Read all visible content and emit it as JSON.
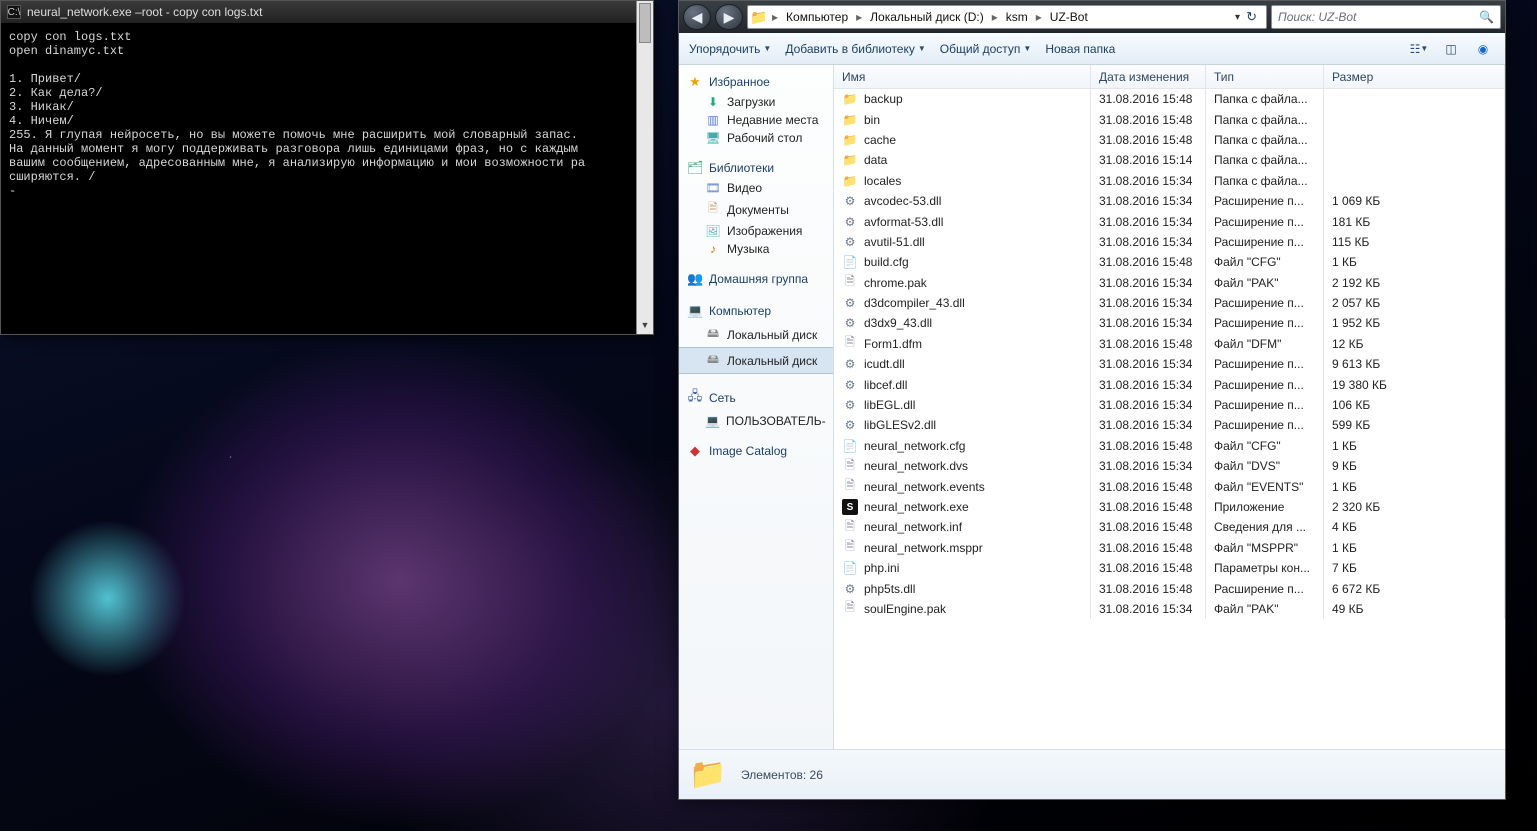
{
  "terminal": {
    "title": "neural_network.exe –root - copy  con logs.txt",
    "lines": "copy con logs.txt\nopen dinamyc.txt\n\n1. Привет/\n2. Как дела?/\n3. Никак/\n4. Ничем/\n255. Я глупая нейросеть, но вы можете помочь мне расширить мой словарный запас.\nНа данный момент я могу поддерживать разговора лишь единицами фраз, но с каждым\nвашим сообщением, адресованным мне, я анализирую информацию и мои возможности ра\nсширяются. /\n-"
  },
  "explorer": {
    "breadcrumb": [
      "Компьютер",
      "Локальный диск (D:)",
      "ksm",
      "UZ-Bot"
    ],
    "search_placeholder": "Поиск: UZ-Bot",
    "toolbar": {
      "organize": "Упорядочить",
      "library": "Добавить в библиотеку",
      "share": "Общий доступ",
      "newfolder": "Новая папка"
    },
    "sidebar": {
      "fav": {
        "head": "Избранное",
        "items": [
          "Загрузки",
          "Недавние места",
          "Рабочий стол"
        ]
      },
      "lib": {
        "head": "Библиотеки",
        "items": [
          "Видео",
          "Документы",
          "Изображения",
          "Музыка"
        ]
      },
      "home": {
        "head": "Домашняя группа"
      },
      "comp": {
        "head": "Компьютер",
        "items": [
          "Локальный диск",
          "Локальный диск"
        ]
      },
      "net": {
        "head": "Сеть",
        "items": [
          "ПОЛЬЗОВАТЕЛЬ-"
        ]
      },
      "catalog": {
        "head": "Image Catalog"
      }
    },
    "columns": {
      "name": "Имя",
      "date": "Дата изменения",
      "type": "Тип",
      "size": "Размер"
    },
    "files": [
      {
        "ico": "folder",
        "name": "backup",
        "date": "31.08.2016 15:48",
        "type": "Папка с файла...",
        "size": ""
      },
      {
        "ico": "folder",
        "name": "bin",
        "date": "31.08.2016 15:48",
        "type": "Папка с файла...",
        "size": ""
      },
      {
        "ico": "folder",
        "name": "cache",
        "date": "31.08.2016 15:48",
        "type": "Папка с файла...",
        "size": ""
      },
      {
        "ico": "folder",
        "name": "data",
        "date": "31.08.2016 15:14",
        "type": "Папка с файла...",
        "size": ""
      },
      {
        "ico": "folder",
        "name": "locales",
        "date": "31.08.2016 15:34",
        "type": "Папка с файла...",
        "size": ""
      },
      {
        "ico": "dll",
        "name": "avcodec-53.dll",
        "date": "31.08.2016 15:34",
        "type": "Расширение п...",
        "size": "1 069 КБ"
      },
      {
        "ico": "dll",
        "name": "avformat-53.dll",
        "date": "31.08.2016 15:34",
        "type": "Расширение п...",
        "size": "181 КБ"
      },
      {
        "ico": "dll",
        "name": "avutil-51.dll",
        "date": "31.08.2016 15:34",
        "type": "Расширение п...",
        "size": "115 КБ"
      },
      {
        "ico": "cfg",
        "name": "build.cfg",
        "date": "31.08.2016 15:48",
        "type": "Файл \"CFG\"",
        "size": "1 КБ"
      },
      {
        "ico": "file",
        "name": "chrome.pak",
        "date": "31.08.2016 15:34",
        "type": "Файл \"PAK\"",
        "size": "2 192 КБ"
      },
      {
        "ico": "dll",
        "name": "d3dcompiler_43.dll",
        "date": "31.08.2016 15:34",
        "type": "Расширение п...",
        "size": "2 057 КБ"
      },
      {
        "ico": "dll",
        "name": "d3dx9_43.dll",
        "date": "31.08.2016 15:34",
        "type": "Расширение п...",
        "size": "1 952 КБ"
      },
      {
        "ico": "file",
        "name": "Form1.dfm",
        "date": "31.08.2016 15:48",
        "type": "Файл \"DFM\"",
        "size": "12 КБ"
      },
      {
        "ico": "dll",
        "name": "icudt.dll",
        "date": "31.08.2016 15:34",
        "type": "Расширение п...",
        "size": "9 613 КБ"
      },
      {
        "ico": "dll",
        "name": "libcef.dll",
        "date": "31.08.2016 15:34",
        "type": "Расширение п...",
        "size": "19 380 КБ"
      },
      {
        "ico": "dll",
        "name": "libEGL.dll",
        "date": "31.08.2016 15:34",
        "type": "Расширение п...",
        "size": "106 КБ"
      },
      {
        "ico": "dll",
        "name": "libGLESv2.dll",
        "date": "31.08.2016 15:34",
        "type": "Расширение п...",
        "size": "599 КБ"
      },
      {
        "ico": "cfg",
        "name": "neural_network.cfg",
        "date": "31.08.2016 15:48",
        "type": "Файл \"CFG\"",
        "size": "1 КБ"
      },
      {
        "ico": "file",
        "name": "neural_network.dvs",
        "date": "31.08.2016 15:34",
        "type": "Файл \"DVS\"",
        "size": "9 КБ"
      },
      {
        "ico": "file",
        "name": "neural_network.events",
        "date": "31.08.2016 15:48",
        "type": "Файл \"EVENTS\"",
        "size": "1 КБ"
      },
      {
        "ico": "exe",
        "name": "neural_network.exe",
        "date": "31.08.2016 15:48",
        "type": "Приложение",
        "size": "2 320 КБ"
      },
      {
        "ico": "file",
        "name": "neural_network.inf",
        "date": "31.08.2016 15:48",
        "type": "Сведения для ...",
        "size": "4 КБ"
      },
      {
        "ico": "file",
        "name": "neural_network.msppr",
        "date": "31.08.2016 15:48",
        "type": "Файл \"MSPPR\"",
        "size": "1 КБ"
      },
      {
        "ico": "cfg",
        "name": "php.ini",
        "date": "31.08.2016 15:48",
        "type": "Параметры кон...",
        "size": "7 КБ"
      },
      {
        "ico": "dll",
        "name": "php5ts.dll",
        "date": "31.08.2016 15:48",
        "type": "Расширение п...",
        "size": "6 672 КБ"
      },
      {
        "ico": "file",
        "name": "soulEngine.pak",
        "date": "31.08.2016 15:34",
        "type": "Файл \"PAK\"",
        "size": "49 КБ"
      }
    ],
    "status": "Элементов: 26"
  }
}
